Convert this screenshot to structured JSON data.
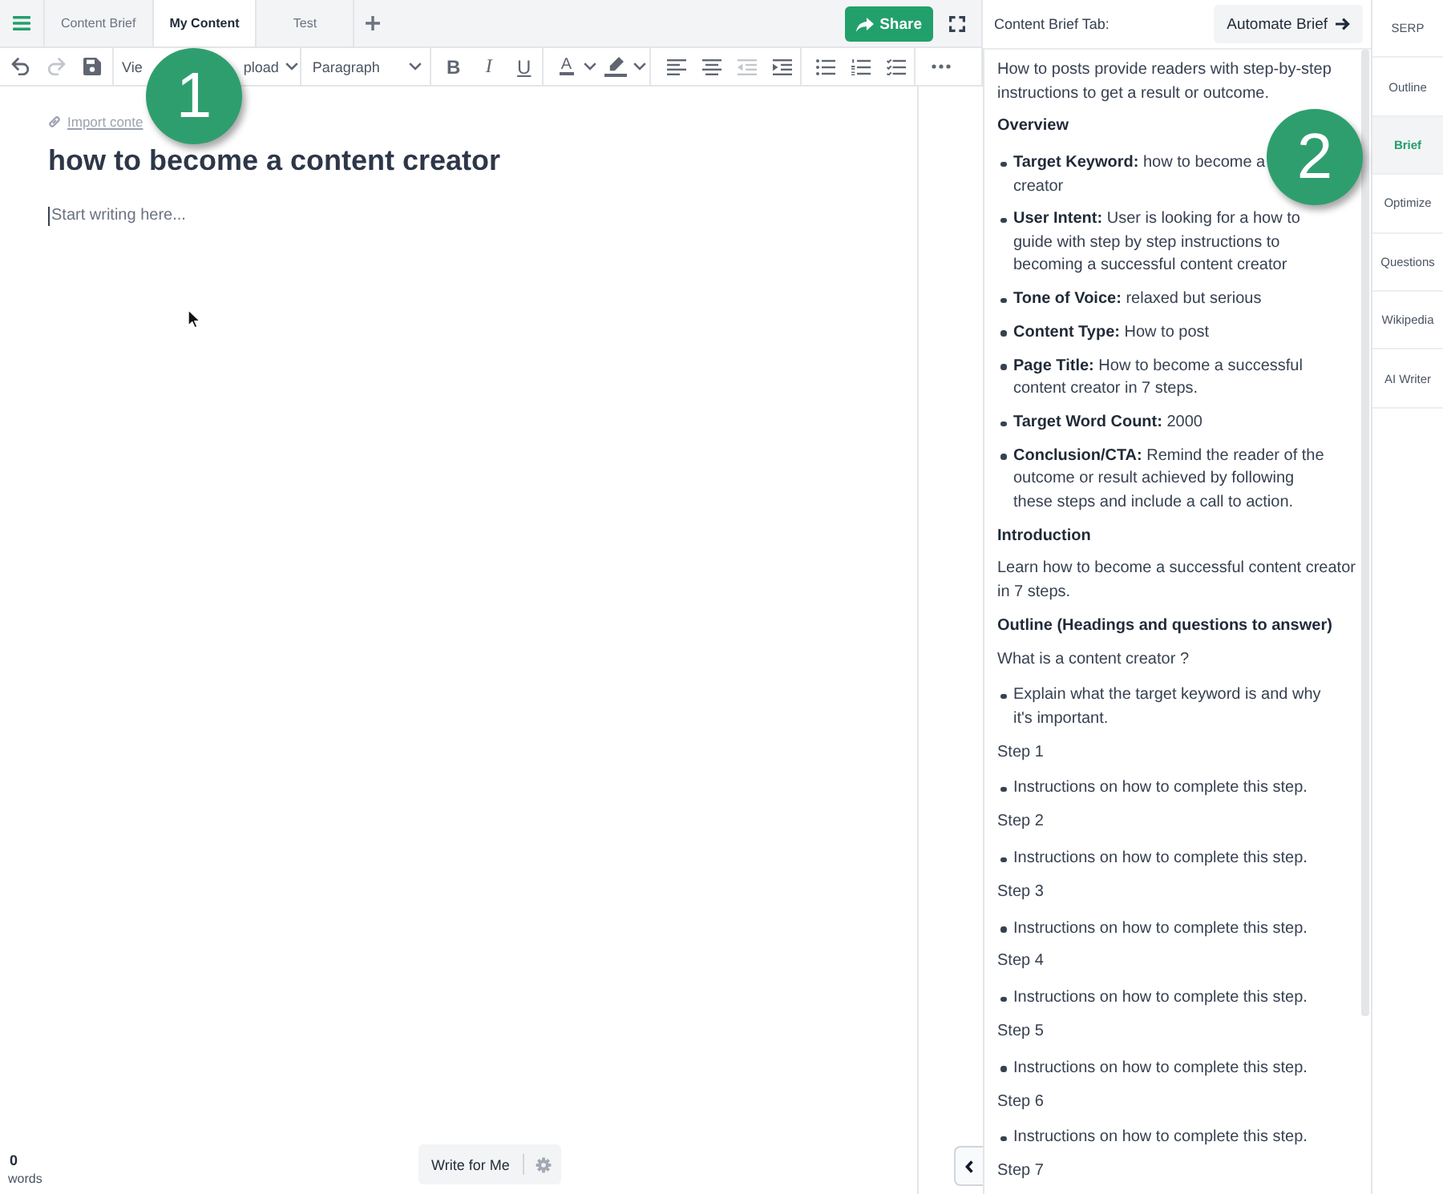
{
  "top_bar": {
    "tabs": [
      {
        "label": "Content Brief",
        "selected": false
      },
      {
        "label": "My Content",
        "selected": true
      },
      {
        "label": "Test",
        "selected": false
      }
    ],
    "share_button": "Share"
  },
  "toolbar": {
    "undo_disabled": false,
    "redo_disabled": true,
    "dropdowns": [
      {
        "label": "Vie",
        "caret": false
      },
      {
        "label": "pload",
        "caret": true
      }
    ],
    "block_format": "Paragraph",
    "format_buttons": [
      {
        "kind": "bold",
        "label": "B"
      },
      {
        "kind": "italic",
        "label": "I"
      },
      {
        "kind": "underline",
        "label": "U"
      }
    ],
    "text_color": {
      "label": "A"
    },
    "outdent_disabled": true,
    "indent_disabled": false
  },
  "editor": {
    "import_link": "Import conte",
    "title": "how to become a content creator",
    "placeholder": "Start writing here..."
  },
  "word_count": {
    "count": "0",
    "label": "words"
  },
  "write_for_me_button": "Write for Me",
  "brief_panel": {
    "title": "Content Brief Tab:",
    "automate_button": "Automate Brief",
    "blocks": [
      {
        "kind": "paragraph",
        "text": "How to posts provide readers with step-by-step instructions to get a result or outcome."
      },
      {
        "kind": "heading",
        "text": "Overview"
      },
      {
        "kind": "list",
        "items": [
          {
            "lines": [
              "**Target Keyword:** how to become a",
              "creator"
            ]
          },
          {
            "text": "**User Intent:** User is looking for a how to guide with step by step instructions to becoming a successful content creator"
          },
          {
            "text": "**Tone of Voice:** relaxed but serious"
          },
          {
            "text": "**Content Type:** How to post"
          },
          {
            "text": "**Page Title:** How to become a successful content creator in 7 steps."
          },
          {
            "text": "**Target Word Count:** 2000"
          },
          {
            "text": "**Conclusion/CTA:** Remind the reader of the outcome or result achieved by following these steps and include a call to action."
          }
        ]
      },
      {
        "kind": "heading",
        "text": "Introduction"
      },
      {
        "kind": "paragraph",
        "text": "Learn how to become a successful content creator in 7 steps."
      },
      {
        "kind": "heading",
        "text": "Outline (Headings and questions to answer)"
      },
      {
        "kind": "paragraph",
        "text": "What is a content creator ?"
      },
      {
        "kind": "list",
        "items": [
          {
            "text": "Explain what the target keyword is and why it's important."
          }
        ]
      },
      {
        "kind": "paragraph",
        "text": "Step 1"
      },
      {
        "kind": "list",
        "items": [
          {
            "text": "Instructions on how to complete this step."
          }
        ]
      },
      {
        "kind": "paragraph",
        "text": "Step 2"
      },
      {
        "kind": "list",
        "items": [
          {
            "text": "Instructions on how to complete this step."
          }
        ]
      },
      {
        "kind": "paragraph",
        "text": "Step 3"
      },
      {
        "kind": "list",
        "items": [
          {
            "text": "Instructions on how to complete this step."
          }
        ]
      },
      {
        "kind": "paragraph",
        "text": "Step 4"
      },
      {
        "kind": "list",
        "items": [
          {
            "text": "Instructions on how to complete this step."
          }
        ]
      },
      {
        "kind": "paragraph",
        "text": "Step 5"
      },
      {
        "kind": "list",
        "items": [
          {
            "text": "Instructions on how to complete this step."
          }
        ]
      },
      {
        "kind": "paragraph",
        "text": "Step 6"
      },
      {
        "kind": "list",
        "items": [
          {
            "text": "Instructions on how to complete this step."
          }
        ]
      },
      {
        "kind": "paragraph",
        "text": "Step 7"
      }
    ]
  },
  "sidebar": {
    "items": [
      {
        "label": "SERP",
        "selected": false
      },
      {
        "label": "Outline",
        "selected": false
      },
      {
        "label": "Brief",
        "selected": true
      },
      {
        "label": "Optimize",
        "selected": false
      },
      {
        "label": "Questions",
        "selected": false
      },
      {
        "label": "Wikipedia",
        "selected": false
      },
      {
        "label": "AI Writer",
        "selected": false
      }
    ]
  },
  "annotations": [
    {
      "number": "1"
    },
    {
      "number": "2"
    }
  ]
}
